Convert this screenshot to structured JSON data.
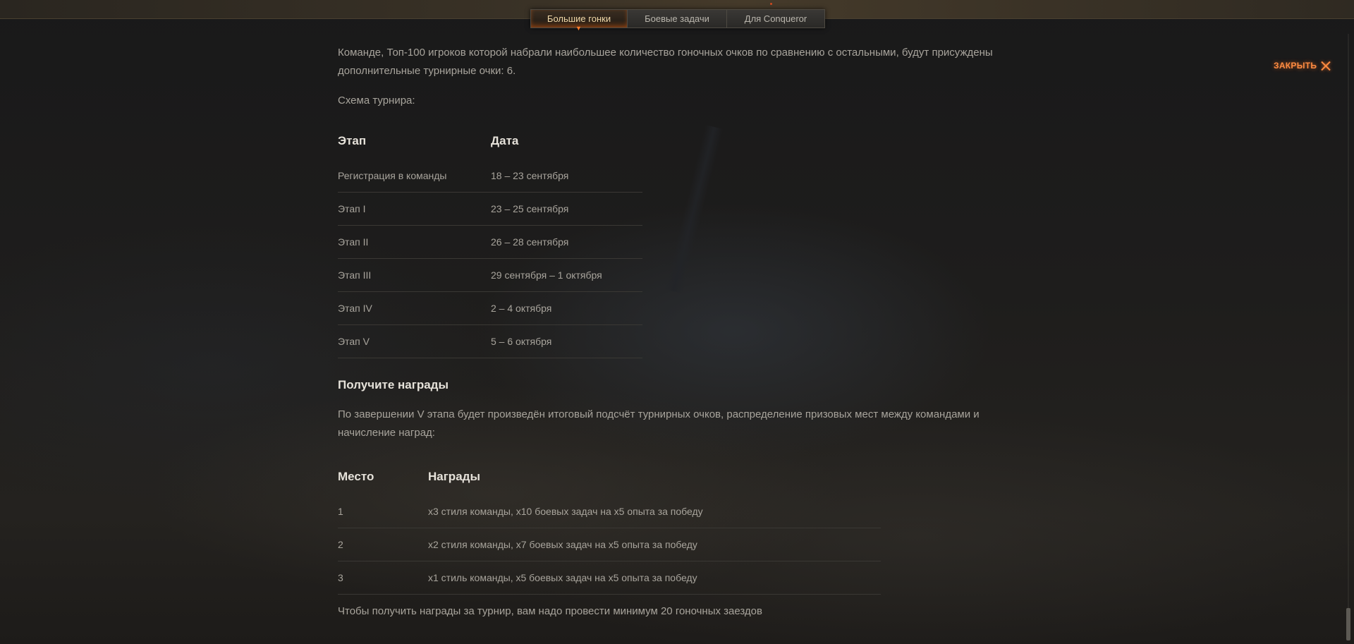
{
  "tabs": [
    {
      "label": "Большие гонки",
      "active": true
    },
    {
      "label": "Боевые задачи",
      "active": false
    },
    {
      "label": "Для Conqueror",
      "active": false
    }
  ],
  "close": {
    "label": "ЗАКРЫТЬ",
    "icon": "close-icon"
  },
  "intro_text": "Команде, Топ-100 игроков которой набрали наибольшее количество гоночных очков по сравнению с остальными, будут присуждены дополнительные турнирные очки: 6.",
  "schema_label": "Схема турнира:",
  "schedule": {
    "headers": {
      "stage": "Этап",
      "date": "Дата"
    },
    "rows": [
      {
        "stage": "Регистрация в команды",
        "date": "18 – 23 сентября"
      },
      {
        "stage": "Этап I",
        "date": "23 – 25 сентября"
      },
      {
        "stage": "Этап II",
        "date": "26 – 28 сентября"
      },
      {
        "stage": "Этап III",
        "date": "29 сентября – 1 октября"
      },
      {
        "stage": "Этап IV",
        "date": "2 – 4 октября"
      },
      {
        "stage": "Этап V",
        "date": "5 – 6 октября"
      }
    ]
  },
  "rewards_heading": "Получите награды",
  "rewards_intro": "По завершении V этапа будет произведён итоговый подсчёт турнирных очков, распределение призовых мест между командами и начисление наград:",
  "rewards": {
    "headers": {
      "place": "Место",
      "rewards": "Награды"
    },
    "rows": [
      {
        "place": "1",
        "rewards": "x3 стиля команды, x10 боевых задач на x5 опыта за победу"
      },
      {
        "place": "2",
        "rewards": "x2 стиля команды, x7 боевых задач на x5 опыта за победу"
      },
      {
        "place": "3",
        "rewards": "x1 стиль команды, x5 боевых задач на x5 опыта за победу"
      }
    ]
  },
  "footnote": "Чтобы получить награды за турнир, вам надо провести минимум 20 гоночных заездов",
  "colors": {
    "accent": "#ff8c42",
    "heading": "#e6e2da",
    "body": "#a8a49c",
    "background": "#1b1a19"
  }
}
